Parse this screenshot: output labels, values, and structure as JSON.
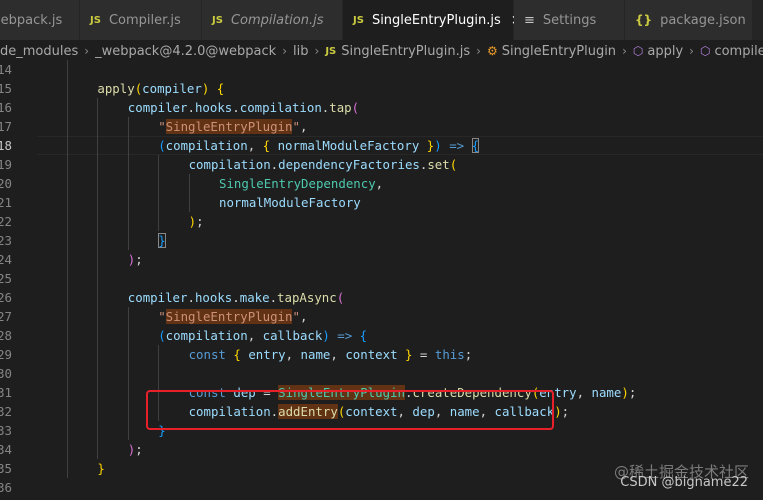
{
  "tabs": [
    {
      "label": "webpack.js",
      "icon": "js-icon",
      "italic": false,
      "active": false
    },
    {
      "label": "Compiler.js",
      "icon": "js-icon",
      "italic": false,
      "active": false
    },
    {
      "label": "Compilation.js",
      "icon": "js-icon",
      "italic": true,
      "active": false
    },
    {
      "label": "SingleEntryPlugin.js",
      "icon": "js-icon",
      "italic": false,
      "active": true
    },
    {
      "label": "Settings",
      "icon": "settings-icon",
      "italic": false,
      "active": false
    },
    {
      "label": "package.json",
      "icon": "json-icon",
      "italic": false,
      "active": false
    }
  ],
  "tab_icon_text": {
    "js": "JS",
    "json": "{}",
    "settings": "≡",
    "close": "×"
  },
  "breadcrumb": [
    {
      "label": "de_modules",
      "icon": ""
    },
    {
      "label": "_webpack@4.2.0@webpack",
      "icon": ""
    },
    {
      "label": "lib",
      "icon": ""
    },
    {
      "label": "SingleEntryPlugin.js",
      "icon": "js"
    },
    {
      "label": "SingleEntryPlugin",
      "icon": "class"
    },
    {
      "label": "apply",
      "icon": "method"
    },
    {
      "label": "compiler.hooks.compilation.tap() callback",
      "icon": "method"
    }
  ],
  "current_line": "18",
  "lines": [
    {
      "n": "14",
      "indent": 0,
      "guides": 1,
      "tokens": []
    },
    {
      "n": "15",
      "indent": 4,
      "guides": 1,
      "tokens": [
        [
          "fn",
          "apply"
        ],
        [
          "br1",
          "("
        ],
        [
          "var",
          "compiler"
        ],
        [
          "br1",
          ")"
        ],
        [
          "pun",
          " "
        ],
        [
          "br1",
          "{"
        ]
      ]
    },
    {
      "n": "16",
      "indent": 8,
      "guides": 2,
      "tokens": [
        [
          "var",
          "compiler"
        ],
        [
          "pun",
          "."
        ],
        [
          "prop",
          "hooks"
        ],
        [
          "pun",
          "."
        ],
        [
          "prop",
          "compilation"
        ],
        [
          "pun",
          "."
        ],
        [
          "fn",
          "tap"
        ],
        [
          "br2",
          "("
        ]
      ]
    },
    {
      "n": "17",
      "indent": 12,
      "guides": 3,
      "tokens": [
        [
          "str",
          "\""
        ],
        [
          "str hl-str",
          "SingleEntryPlugin"
        ],
        [
          "str",
          "\""
        ],
        [
          "pun",
          ","
        ]
      ]
    },
    {
      "n": "18",
      "indent": 12,
      "guides": 3,
      "tokens": [
        [
          "br3",
          "("
        ],
        [
          "var",
          "compilation"
        ],
        [
          "pun",
          ", "
        ],
        [
          "br1",
          "{"
        ],
        [
          "pun",
          " "
        ],
        [
          "var",
          "normalModuleFactory"
        ],
        [
          "pun",
          " "
        ],
        [
          "br1",
          "}"
        ],
        [
          "br3",
          ")"
        ],
        [
          "pun",
          " "
        ],
        [
          "kw",
          "=>"
        ],
        [
          "pun",
          " "
        ],
        [
          "br3 bracket-match",
          "{"
        ]
      ]
    },
    {
      "n": "19",
      "indent": 16,
      "guides": 4,
      "tokens": [
        [
          "var",
          "compilation"
        ],
        [
          "pun",
          "."
        ],
        [
          "prop",
          "dependencyFactories"
        ],
        [
          "pun",
          "."
        ],
        [
          "fn",
          "set"
        ],
        [
          "br1",
          "("
        ]
      ]
    },
    {
      "n": "20",
      "indent": 20,
      "guides": 5,
      "tokens": [
        [
          "cls",
          "SingleEntryDependency"
        ],
        [
          "pun",
          ","
        ]
      ]
    },
    {
      "n": "21",
      "indent": 20,
      "guides": 5,
      "tokens": [
        [
          "var",
          "normalModuleFactory"
        ]
      ]
    },
    {
      "n": "22",
      "indent": 16,
      "guides": 4,
      "tokens": [
        [
          "br1",
          ")"
        ],
        [
          "pun",
          ";"
        ]
      ]
    },
    {
      "n": "23",
      "indent": 12,
      "guides": 3,
      "tokens": [
        [
          "br3 bracket-match",
          "}"
        ]
      ]
    },
    {
      "n": "24",
      "indent": 8,
      "guides": 2,
      "tokens": [
        [
          "br2",
          ")"
        ],
        [
          "pun",
          ";"
        ]
      ]
    },
    {
      "n": "25",
      "indent": 0,
      "guides": 2,
      "tokens": []
    },
    {
      "n": "26",
      "indent": 8,
      "guides": 2,
      "tokens": [
        [
          "var",
          "compiler"
        ],
        [
          "pun",
          "."
        ],
        [
          "prop",
          "hooks"
        ],
        [
          "pun",
          "."
        ],
        [
          "prop",
          "make"
        ],
        [
          "pun",
          "."
        ],
        [
          "fn",
          "tapAsync"
        ],
        [
          "br2",
          "("
        ]
      ]
    },
    {
      "n": "27",
      "indent": 12,
      "guides": 3,
      "tokens": [
        [
          "str",
          "\""
        ],
        [
          "str hl-str",
          "SingleEntryPlugin"
        ],
        [
          "str",
          "\""
        ],
        [
          "pun",
          ","
        ]
      ]
    },
    {
      "n": "28",
      "indent": 12,
      "guides": 3,
      "tokens": [
        [
          "br3",
          "("
        ],
        [
          "var",
          "compilation"
        ],
        [
          "pun",
          ", "
        ],
        [
          "var",
          "callback"
        ],
        [
          "br3",
          ")"
        ],
        [
          "pun",
          " "
        ],
        [
          "kw",
          "=>"
        ],
        [
          "pun",
          " "
        ],
        [
          "br3",
          "{"
        ]
      ]
    },
    {
      "n": "29",
      "indent": 16,
      "guides": 4,
      "tokens": [
        [
          "kw",
          "const"
        ],
        [
          "pun",
          " "
        ],
        [
          "br1",
          "{"
        ],
        [
          "pun",
          " "
        ],
        [
          "var",
          "entry"
        ],
        [
          "pun",
          ", "
        ],
        [
          "var",
          "name"
        ],
        [
          "pun",
          ", "
        ],
        [
          "var",
          "context"
        ],
        [
          "pun",
          " "
        ],
        [
          "br1",
          "}"
        ],
        [
          "pun",
          " = "
        ],
        [
          "kw",
          "this"
        ],
        [
          "pun",
          ";"
        ]
      ]
    },
    {
      "n": "30",
      "indent": 0,
      "guides": 4,
      "tokens": []
    },
    {
      "n": "31",
      "indent": 16,
      "guides": 4,
      "tokens": [
        [
          "kw",
          "const"
        ],
        [
          "pun",
          " "
        ],
        [
          "var",
          "dep"
        ],
        [
          "pun",
          " = "
        ],
        [
          "cls hl-word",
          "SingleEntryPlugin"
        ],
        [
          "pun",
          "."
        ],
        [
          "fn",
          "createDependency"
        ],
        [
          "br1",
          "("
        ],
        [
          "var",
          "entry"
        ],
        [
          "pun",
          ", "
        ],
        [
          "var",
          "name"
        ],
        [
          "br1",
          ")"
        ],
        [
          "pun",
          ";"
        ]
      ]
    },
    {
      "n": "32",
      "indent": 16,
      "guides": 4,
      "tokens": [
        [
          "var",
          "compilation"
        ],
        [
          "pun",
          "."
        ],
        [
          "fn hl-word",
          "addEntry"
        ],
        [
          "br1",
          "("
        ],
        [
          "var",
          "context"
        ],
        [
          "pun",
          ", "
        ],
        [
          "var",
          "dep"
        ],
        [
          "pun",
          ", "
        ],
        [
          "var",
          "name"
        ],
        [
          "pun",
          ", "
        ],
        [
          "var",
          "callback"
        ],
        [
          "br1",
          ")"
        ],
        [
          "pun",
          ";"
        ]
      ]
    },
    {
      "n": "33",
      "indent": 12,
      "guides": 3,
      "tokens": [
        [
          "br3",
          "}"
        ]
      ]
    },
    {
      "n": "34",
      "indent": 8,
      "guides": 2,
      "tokens": [
        [
          "br2",
          ")"
        ],
        [
          "pun",
          ";"
        ]
      ]
    },
    {
      "n": "35",
      "indent": 4,
      "guides": 1,
      "tokens": [
        [
          "br1",
          "}"
        ]
      ]
    },
    {
      "n": "36",
      "indent": 0,
      "guides": 0,
      "tokens": []
    }
  ],
  "watermark_cn": "@稀土掘金技术社区",
  "watermark_csdn": "CSDN @bigname22",
  "colors": {
    "editor_bg": "#1e1e1e",
    "tab_inactive_bg": "#2d2d2d",
    "annotation_box": "#e8202a",
    "js_icon": "#cbcb41"
  }
}
